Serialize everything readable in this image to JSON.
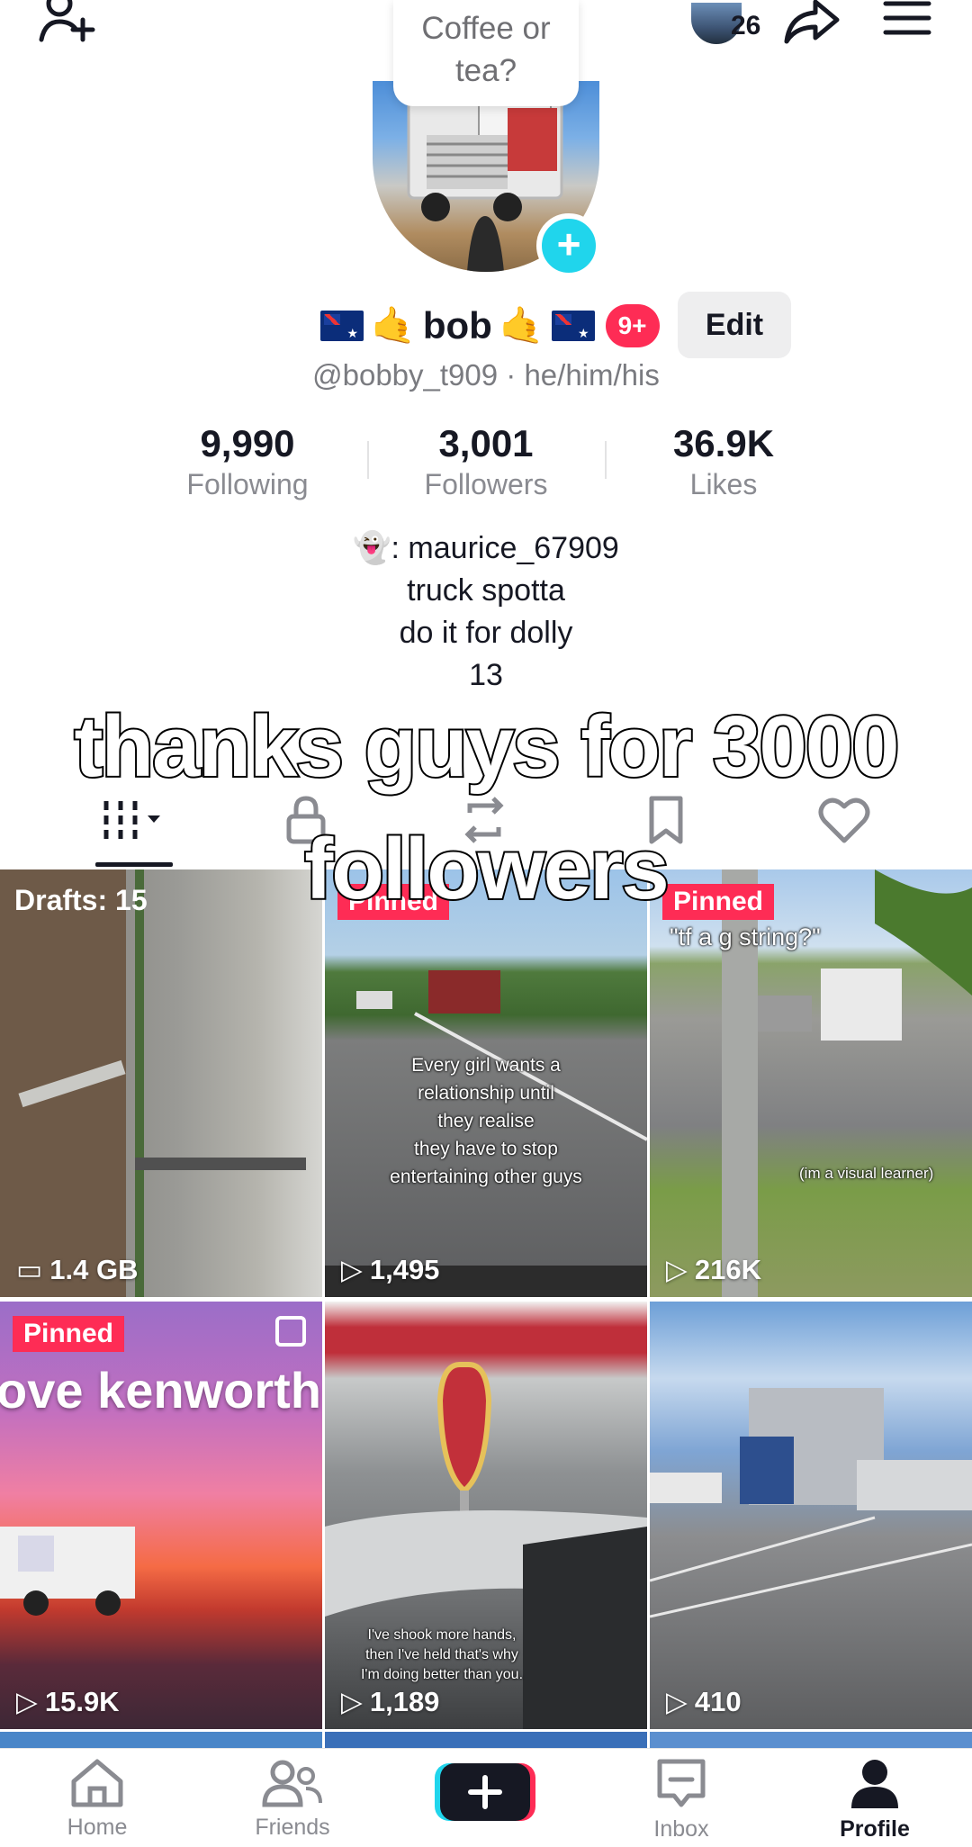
{
  "header": {
    "note_bubble": [
      "Coffee or",
      "tea?"
    ],
    "visitor_count": "26",
    "icons": [
      "add-friend-icon",
      "share-icon",
      "menu-icon"
    ]
  },
  "profile": {
    "name": "bob",
    "notifications": "9+",
    "edit_label": "Edit",
    "handle_line": "@bobby_t909 · he/him/his"
  },
  "stats": [
    {
      "value": "9,990",
      "label": "Following"
    },
    {
      "value": "3,001",
      "label": "Followers"
    },
    {
      "value": "36.9K",
      "label": "Likes"
    }
  ],
  "bio": {
    "line1": ": maurice_67909",
    "line2": "truck spotta",
    "line3": "do it for dolly",
    "line4": "13"
  },
  "caption_overlay": "thanks guys for 3000 followers",
  "tabs": [
    "videos-grid-icon",
    "private-lock-icon",
    "reposts-icon",
    "favorites-bookmark-icon",
    "liked-heart-icon"
  ],
  "grid": [
    {
      "badge": "Drafts: 15",
      "stat": "1.4 GB"
    },
    {
      "badge": "Pinned",
      "text": [
        "Every girl wants a",
        "relationship until",
        "they realise",
        "they have to stop",
        "entertaining other guys"
      ],
      "stat": "1,495"
    },
    {
      "badge": "Pinned",
      "top_text": "\"tf a g string?\"",
      "side_text": "(im a visual learner)",
      "stat": "216K"
    },
    {
      "badge": "Pinned",
      "title_text": "ove kenworth",
      "stat": "15.9K"
    },
    {
      "text": [
        "I've shook more hands,",
        "then I've held that's why",
        "I'm doing better than you."
      ],
      "stat": "1,189"
    },
    {
      "stat": "410"
    }
  ],
  "bottom_nav": [
    {
      "label": "Home",
      "icon": "home-icon"
    },
    {
      "label": "Friends",
      "icon": "friends-icon"
    },
    {
      "label": "",
      "icon": "create-plus-icon"
    },
    {
      "label": "Inbox",
      "icon": "inbox-icon"
    },
    {
      "label": "Profile",
      "icon": "profile-icon"
    }
  ],
  "colors": {
    "accent": "#fe2c55",
    "cyan": "#20d5ec",
    "text": "#161823",
    "muted": "#8a8b91"
  }
}
